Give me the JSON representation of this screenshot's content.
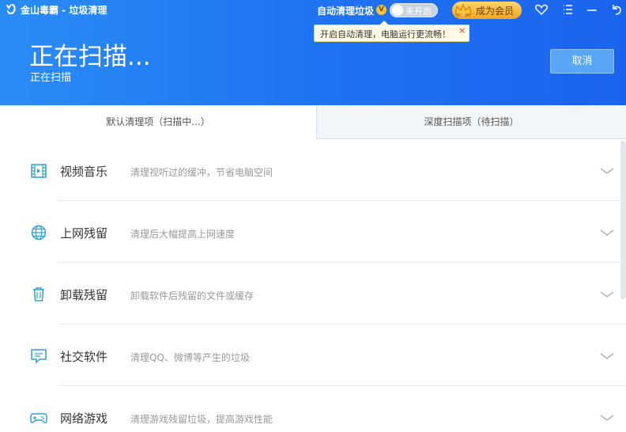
{
  "titlebar": {
    "title": "金山毒霸 - 垃圾清理",
    "auto_clean_label": "自动清理垃圾",
    "vip_badge": "V",
    "toggle_text": "未开启",
    "vip_button_label": "成为会员",
    "icons": [
      "logo-icon",
      "heart-icon",
      "menu-icon",
      "minimize-icon",
      "back-icon"
    ]
  },
  "tooltip": {
    "text": "开启自动清理，电脑运行更流畅！",
    "close": "×"
  },
  "scan": {
    "title": "正在扫描...",
    "subtitle": "正在扫描",
    "cancel_label": "取消"
  },
  "tabs": [
    {
      "label": "默认清理项（扫描中...）",
      "active": true
    },
    {
      "label": "深度扫描项（待扫描）",
      "active": false
    }
  ],
  "items": [
    {
      "title": "视频音乐",
      "desc": "清理视听过的缓冲，节省电脑空间",
      "icon": "film-icon"
    },
    {
      "title": "上网残留",
      "desc": "清理后大幅提高上网速度",
      "icon": "globe-icon"
    },
    {
      "title": "卸载残留",
      "desc": "卸载软件后残留的文件或缓存",
      "icon": "trash-icon"
    },
    {
      "title": "社交软件",
      "desc": "清理QQ、微博等产生的垃圾",
      "icon": "chat-icon"
    },
    {
      "title": "网络游戏",
      "desc": "清理游戏残留垃圾，提高游戏性能",
      "icon": "gamepad-icon"
    }
  ],
  "colors": {
    "header_blue": "#1f76f2",
    "icon_teal": "#2aa3d6",
    "vip_gold": "#f3a620"
  }
}
